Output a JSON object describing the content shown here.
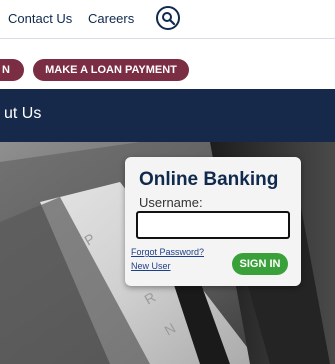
{
  "topnav": {
    "contact_label": "Contact Us",
    "careers_label": "Careers",
    "search_icon": "search-icon"
  },
  "actions": {
    "left_pill_label": "N",
    "loan_payment_label": "MAKE A LOAN PAYMENT"
  },
  "band": {
    "title": "ut Us"
  },
  "login": {
    "heading": "Online Banking",
    "username_label": "Username:",
    "username_value": "",
    "forgot_password_label": "Forgot Password?",
    "new_user_label": "New User",
    "sign_in_label": "SIGN IN"
  },
  "colors": {
    "navy": "#16294a",
    "maroon": "#7b2d43",
    "green": "#3aa13a"
  }
}
